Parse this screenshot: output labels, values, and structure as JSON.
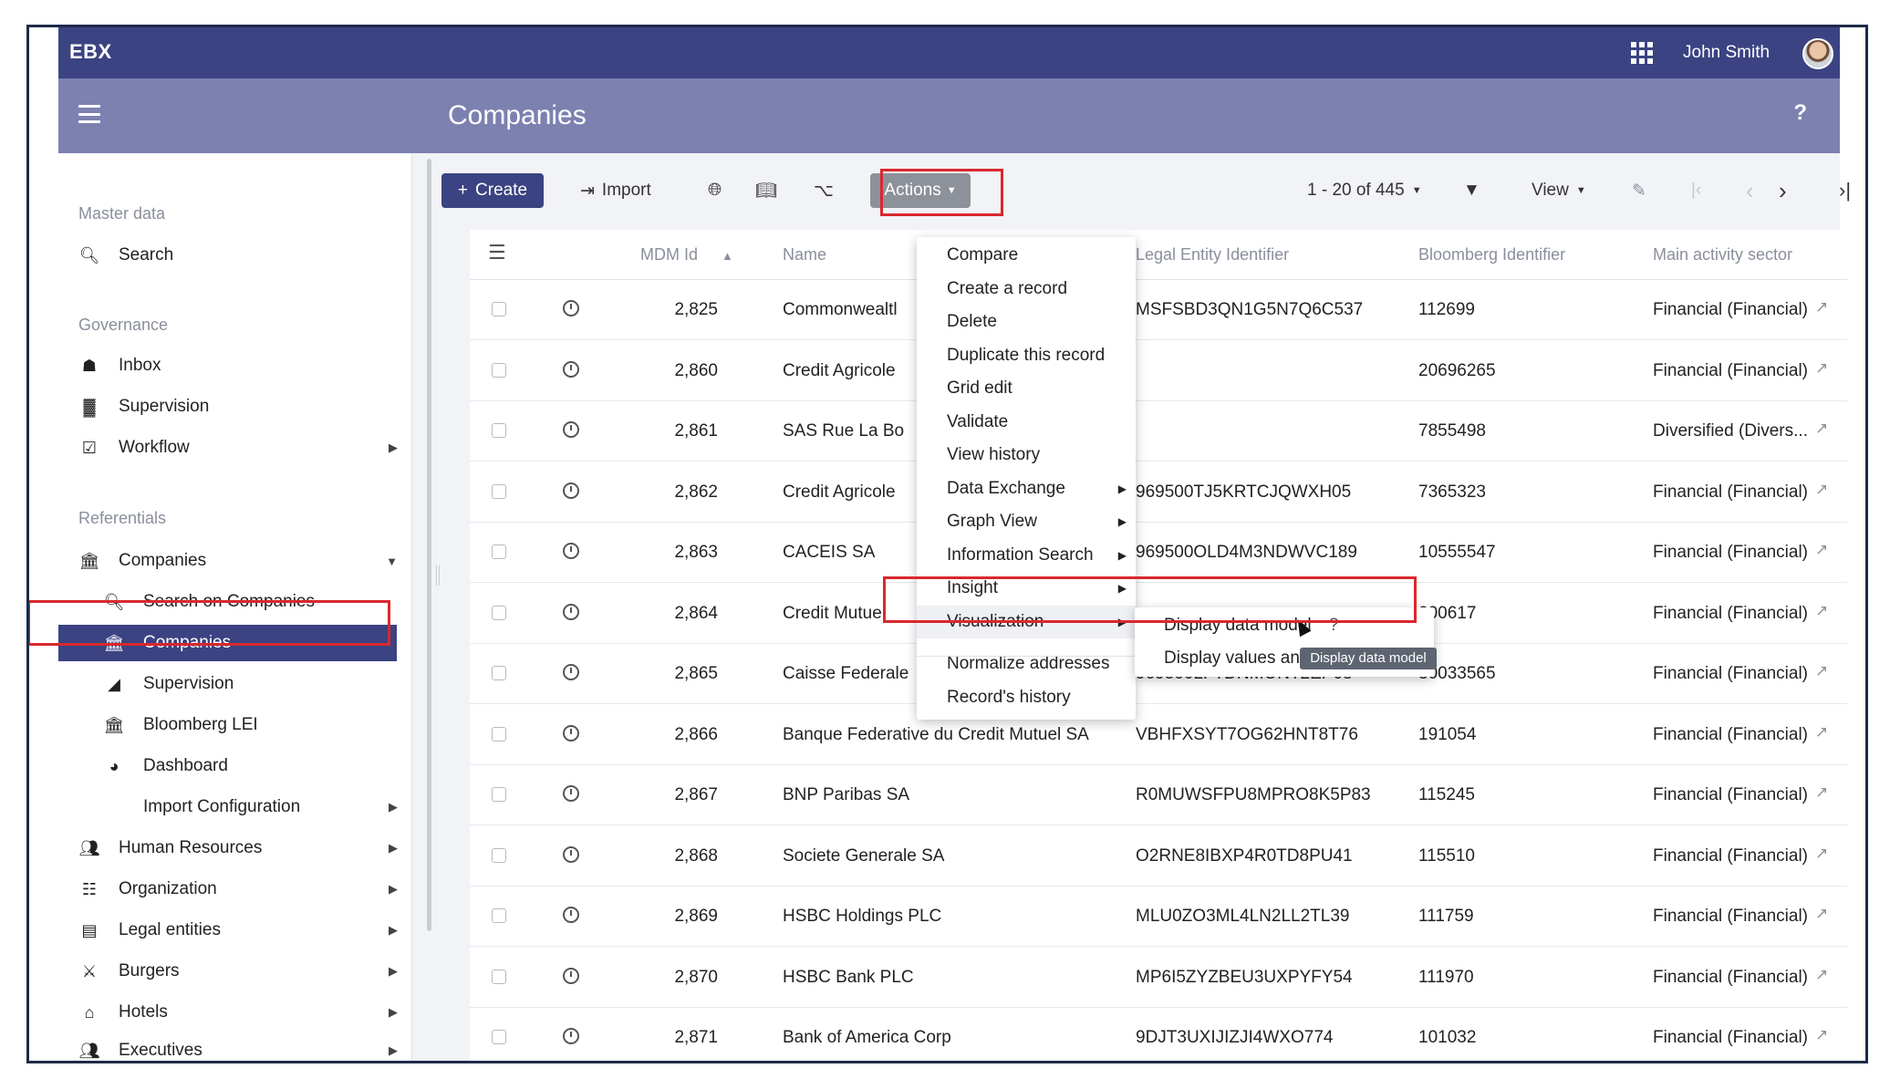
{
  "topbar": {
    "brand": "EBX",
    "user_name": "John Smith"
  },
  "header": {
    "title": "Companies",
    "help": "?"
  },
  "sidebar": {
    "sections": [
      {
        "label": "Master data"
      },
      {
        "label": "Governance"
      },
      {
        "label": "Referentials"
      }
    ],
    "items": [
      {
        "label": "Search",
        "icon": "search-icon"
      },
      {
        "label": "Inbox",
        "icon": "inbox-icon"
      },
      {
        "label": "Supervision",
        "icon": "bar-chart-icon"
      },
      {
        "label": "Workflow",
        "icon": "checkbox-icon"
      },
      {
        "label": "Companies",
        "icon": "bank-icon"
      },
      {
        "label": "Search on Companies",
        "icon": "search-icon"
      },
      {
        "label": "Companies",
        "icon": "bank-icon"
      },
      {
        "label": "Supervision",
        "icon": "area-chart-icon"
      },
      {
        "label": "Bloomberg LEI",
        "icon": "bank-icon"
      },
      {
        "label": "Dashboard",
        "icon": "pie-chart-icon"
      },
      {
        "label": "Import Configuration",
        "icon": ""
      },
      {
        "label": "Human Resources",
        "icon": "users-icon"
      },
      {
        "label": "Organization",
        "icon": "sitemap-icon"
      },
      {
        "label": "Legal entities",
        "icon": "document-icon"
      },
      {
        "label": "Burgers",
        "icon": "cutlery-icon"
      },
      {
        "label": "Hotels",
        "icon": "home-icon"
      },
      {
        "label": "Executives",
        "icon": "users-icon"
      }
    ]
  },
  "toolbar": {
    "create": "Create",
    "import": "Import",
    "actions": "Actions",
    "pagination": "1 - 20 of 445",
    "view": "View"
  },
  "table": {
    "columns": [
      "MDM Id",
      "Name",
      "Legal Entity Identifier",
      "Bloomberg Identifier",
      "Main activity sector"
    ],
    "rows": [
      {
        "id": "2,825",
        "name": "Commonwealtl",
        "lei": "MSFSBD3QN1G5N7Q6C537",
        "bloomberg": "112699",
        "sector": "Financial (Financial)"
      },
      {
        "id": "2,860",
        "name": "Credit Agricole",
        "lei": "",
        "bloomberg": "20696265",
        "sector": "Financial (Financial)"
      },
      {
        "id": "2,861",
        "name": "SAS Rue La Bo",
        "lei": "",
        "bloomberg": "7855498",
        "sector": "Diversified (Divers..."
      },
      {
        "id": "2,862",
        "name": "Credit Agricole",
        "lei": "969500TJ5KRTCJQWXH05",
        "bloomberg": "7365323",
        "sector": "Financial (Financial)"
      },
      {
        "id": "2,863",
        "name": "CACEIS SA",
        "lei": "969500OLD4M3NDWVC189",
        "bloomberg": "10555547",
        "sector": "Financial (Financial)"
      },
      {
        "id": "2,864",
        "name": "Credit Mutue",
        "lei": "",
        "bloomberg": "200617",
        "sector": "Financial (Financial)"
      },
      {
        "id": "2,865",
        "name": "Caisse Federale",
        "lei": "969500LFTDNMONT2EP08",
        "bloomberg": "30033565",
        "sector": "Financial (Financial)"
      },
      {
        "id": "2,866",
        "name": "Banque Federative du Credit Mutuel SA",
        "lei": "VBHFXSYT7OG62HNT8T76",
        "bloomberg": "191054",
        "sector": "Financial (Financial)"
      },
      {
        "id": "2,867",
        "name": "BNP Paribas SA",
        "lei": "R0MUWSFPU8MPRO8K5P83",
        "bloomberg": "115245",
        "sector": "Financial (Financial)"
      },
      {
        "id": "2,868",
        "name": "Societe Generale SA",
        "lei": "O2RNE8IBXP4R0TD8PU41",
        "bloomberg": "115510",
        "sector": "Financial (Financial)"
      },
      {
        "id": "2,869",
        "name": "HSBC Holdings PLC",
        "lei": "MLU0ZO3ML4LN2LL2TL39",
        "bloomberg": "111759",
        "sector": "Financial (Financial)"
      },
      {
        "id": "2,870",
        "name": "HSBC Bank PLC",
        "lei": "MP6I5ZYZBEU3UXPYFY54",
        "bloomberg": "111970",
        "sector": "Financial (Financial)"
      },
      {
        "id": "2,871",
        "name": "Bank of America Corp",
        "lei": "9DJT3UXIJIZJI4WXO774",
        "bloomberg": "101032",
        "sector": "Financial (Financial)"
      }
    ]
  },
  "actions_menu": {
    "items": [
      {
        "label": "Compare",
        "submenu": false
      },
      {
        "label": "Create a record",
        "submenu": false
      },
      {
        "label": "Delete",
        "submenu": false
      },
      {
        "label": "Duplicate this record",
        "submenu": false
      },
      {
        "label": "Grid edit",
        "submenu": false
      },
      {
        "label": "Validate",
        "submenu": false
      },
      {
        "label": "View history",
        "submenu": false
      },
      {
        "label": "Data Exchange",
        "submenu": true
      },
      {
        "label": "Graph View",
        "submenu": true
      },
      {
        "label": "Information Search",
        "submenu": true
      },
      {
        "label": "Insight",
        "submenu": true
      },
      {
        "label": "Visualization",
        "submenu": true
      },
      {
        "label": "Normalize addresses",
        "submenu": false
      },
      {
        "label": "Record's history",
        "submenu": false
      }
    ],
    "visualization_submenu": [
      {
        "label": "Display data model",
        "help": "?"
      },
      {
        "label": "Display values anc"
      }
    ],
    "tooltip": "Display data model"
  }
}
